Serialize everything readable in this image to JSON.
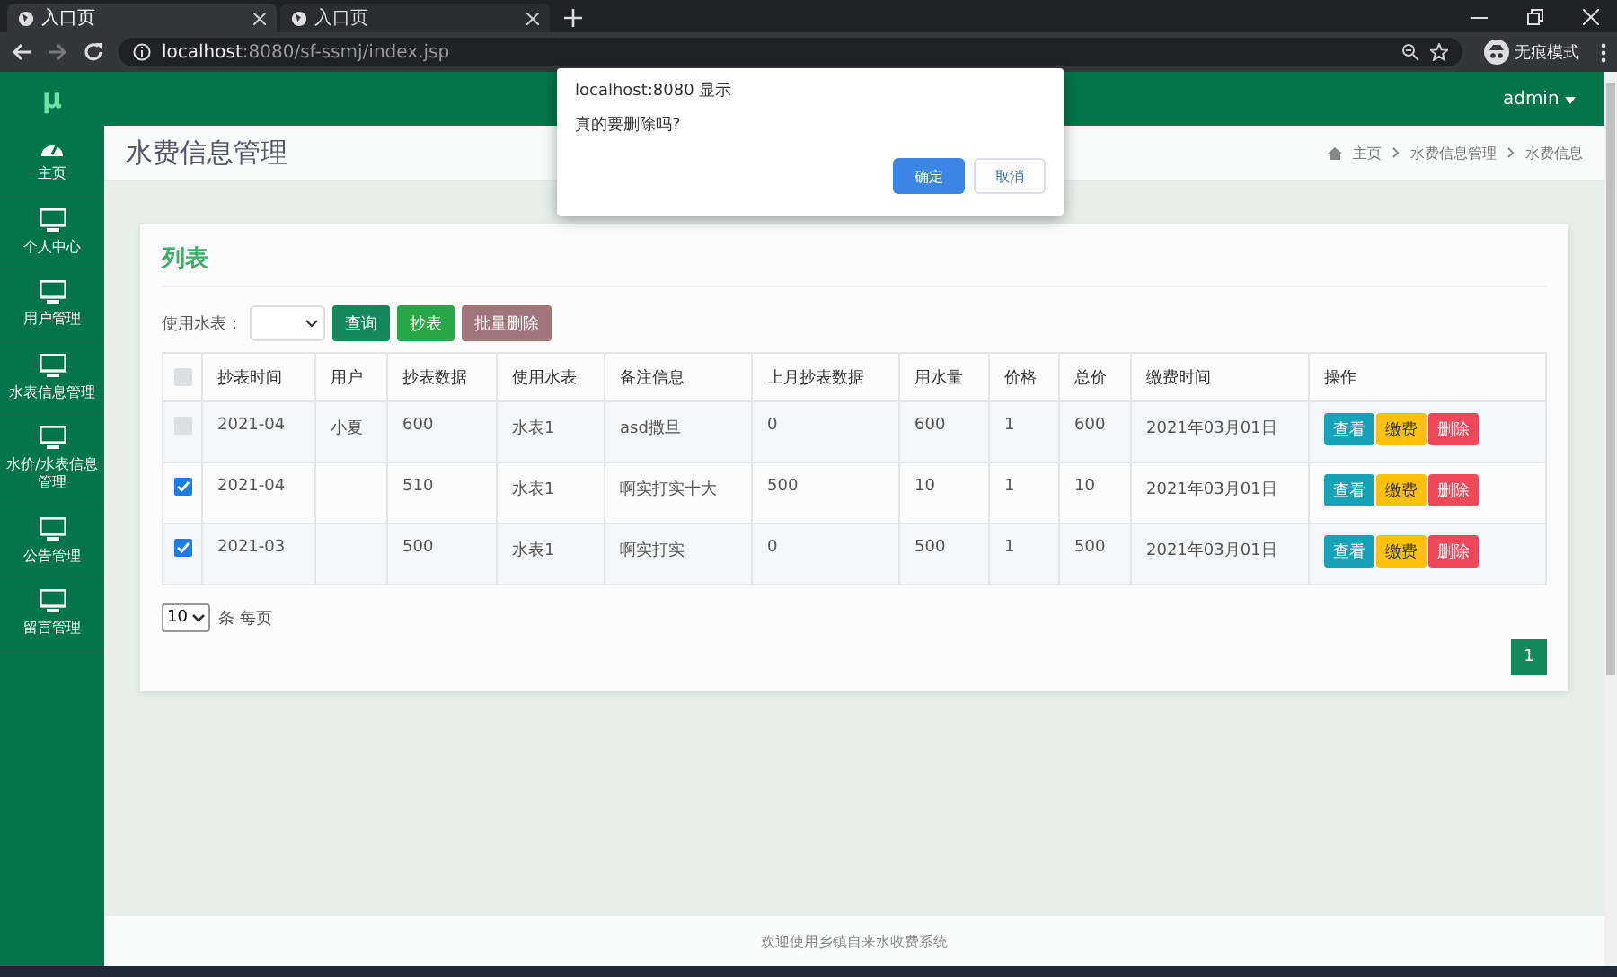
{
  "browser": {
    "tabs": [
      {
        "title": "入口页",
        "selected": true
      },
      {
        "title": "入口页",
        "selected": false
      }
    ],
    "url": {
      "host": "localhost",
      "rest": ":8080/sf-ssmj/index.jsp"
    },
    "incognito": "无痕模式"
  },
  "header": {
    "logo": "μ",
    "user": "admin"
  },
  "sidebar": {
    "items": [
      {
        "label": "主页",
        "kind": "gauge"
      },
      {
        "label": "个人中心",
        "kind": "monitor"
      },
      {
        "label": "用户管理",
        "kind": "monitor"
      },
      {
        "label": "水表信息管理",
        "kind": "monitor"
      },
      {
        "label": "水价/水表信息管理",
        "kind": "monitor"
      },
      {
        "label": "公告管理",
        "kind": "monitor"
      },
      {
        "label": "留言管理",
        "kind": "monitor"
      }
    ]
  },
  "page": {
    "title": "水费信息管理",
    "breadcrumb": [
      "主页",
      "水费信息管理",
      "水费信息"
    ]
  },
  "card": {
    "title": "列表",
    "filter_label": "使用水表：",
    "buttons": [
      {
        "label": "查询",
        "kind": "teal"
      },
      {
        "label": "抄表",
        "kind": "green"
      },
      {
        "label": "批量删除",
        "kind": "muted"
      }
    ]
  },
  "table": {
    "header_checked": false,
    "columns": [
      "抄表时间",
      "用户",
      "抄表数据",
      "使用水表",
      "备注信息",
      "上月抄表数据",
      "用水量",
      "价格",
      "总价",
      "缴费时间",
      "操作"
    ],
    "rows": [
      {
        "checked": false,
        "cells": [
          "2021-04",
          "小夏",
          "600",
          "水表1",
          "asd撒旦",
          "0",
          "600",
          "1",
          "600",
          "2021年03月01日"
        ],
        "actions": [
          "查看",
          "缴费",
          "删除"
        ]
      },
      {
        "checked": true,
        "cells": [
          "2021-04",
          "",
          "510",
          "水表1",
          "啊实打实十大",
          "500",
          "10",
          "1",
          "10",
          "2021年03月01日"
        ],
        "actions": [
          "查看",
          "缴费",
          "删除"
        ]
      },
      {
        "checked": true,
        "cells": [
          "2021-03",
          "",
          "500",
          "水表1",
          "啊实打实",
          "0",
          "500",
          "1",
          "500",
          "2021年03月01日"
        ],
        "actions": [
          "查看",
          "缴费",
          "删除"
        ]
      }
    ]
  },
  "pagination": {
    "page_size": "10",
    "page_size_label": "条 每页",
    "pages": [
      {
        "label": "1",
        "selected": true
      }
    ]
  },
  "footer": "欢迎使用乡镇自来水收费系统",
  "dialog": {
    "title": "localhost:8080 显示",
    "message": "真的要删除吗?",
    "ok": "确定",
    "cancel": "取消"
  }
}
